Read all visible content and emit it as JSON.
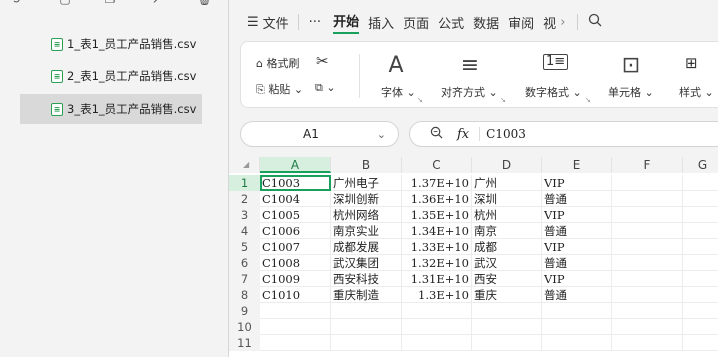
{
  "files": [
    {
      "label": "1_表1_员工产品销售.csv",
      "selected": false
    },
    {
      "label": "2_表1_员工产品销售.csv",
      "selected": false
    },
    {
      "label": "3_表1_员工产品销售.csv",
      "selected": true
    }
  ],
  "file_icon_glyph": "≡",
  "menu": {
    "hamburger": "☰",
    "file": "文件",
    "more": "···",
    "tabs": [
      "开始",
      "插入",
      "页面",
      "公式",
      "数据",
      "审阅",
      "视"
    ],
    "active_tab": "开始",
    "overflow": "›"
  },
  "ribbon": {
    "format_painter": "格式刷",
    "paste": "粘贴",
    "font": "字体",
    "align": "对齐方式",
    "number_format": "数字格式",
    "cell": "单元格",
    "style": "样式",
    "font_glyph": "A",
    "align_glyph": "≡",
    "cell_glyph": "⊡"
  },
  "namebox": {
    "value": "A1"
  },
  "formula_bar": {
    "fx": "fx",
    "value": "C1003"
  },
  "grid": {
    "columns": [
      "A",
      "B",
      "C",
      "D",
      "E",
      "F",
      "G"
    ],
    "active_column": "A",
    "row_numbers": [
      "1",
      "2",
      "3",
      "4",
      "5",
      "6",
      "7",
      "8",
      "9",
      "10",
      "11"
    ],
    "rows": [
      [
        "C1003",
        "广州电子",
        "1.37E+10",
        "广州",
        "VIP"
      ],
      [
        "C1004",
        "深圳创新",
        "1.36E+10",
        "深圳",
        "普通"
      ],
      [
        "C1005",
        "杭州网络",
        "1.35E+10",
        "杭州",
        "VIP"
      ],
      [
        "C1006",
        "南京实业",
        "1.34E+10",
        "南京",
        "普通"
      ],
      [
        "C1007",
        "成都发展",
        "1.33E+10",
        "成都",
        "VIP"
      ],
      [
        "C1008",
        "武汉集团",
        "1.32E+10",
        "武汉",
        "普通"
      ],
      [
        "C1009",
        "西安科技",
        "1.31E+10",
        "西安",
        "VIP"
      ],
      [
        "C1010",
        "重庆制造",
        "1.3E+10",
        "重庆",
        "普通"
      ]
    ]
  },
  "colors": {
    "accent": "#1aa05d",
    "selection_bg": "#d6efdf"
  }
}
